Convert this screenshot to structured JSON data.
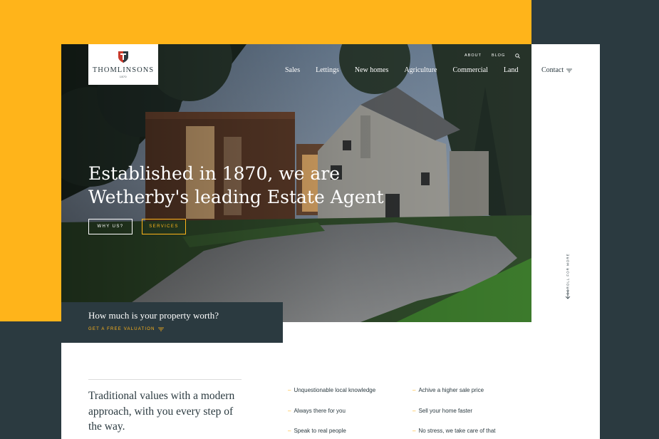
{
  "brand": {
    "name": "THOMLINSONS",
    "year": "1870",
    "accent": "#ffb41a",
    "dark": "#2b3a40"
  },
  "top_links": [
    "ABOUT",
    "BLOG"
  ],
  "nav": {
    "items": [
      "Sales",
      "Lettings",
      "New homes",
      "Agriculture",
      "Commercial",
      "Land"
    ],
    "contact": "Contact"
  },
  "hero": {
    "title_line1": "Established in 1870, we are",
    "title_line2": "Wetherby's leading Estate Agent",
    "btn_why": "WHY US?",
    "btn_services": "SERVICES"
  },
  "valuation": {
    "question": "How much is your property worth?",
    "cta": "GET A FREE VALUATION"
  },
  "scroll_label": "SCROLL FOR MORE",
  "intro": {
    "tagline": "Traditional values with a modern approach, with you every step of the way."
  },
  "features": [
    "Unquestionable local knowledge",
    "Achive a higher sale price",
    "Always there for you",
    "Sell your home faster",
    "Speak to real people",
    "No stress, we take care of that"
  ]
}
